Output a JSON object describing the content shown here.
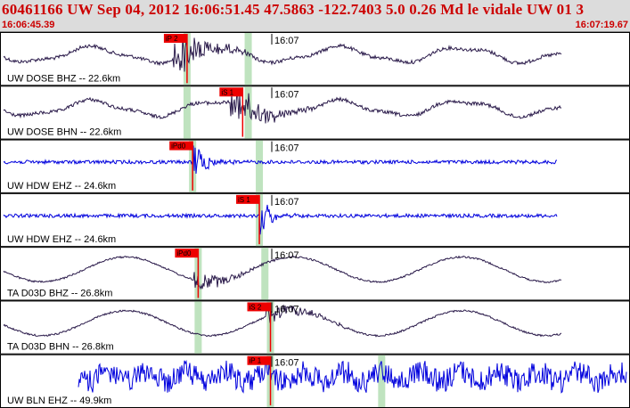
{
  "header": {
    "title": "60461166 UW Sep 04, 2012 16:06:51.45   47.5863 -122.7403  5.0 0.26 Md le vidale UW 01    3",
    "start_time": "16:06:45.39",
    "end_time": "16:07:19.67",
    "tick_time": "16:07"
  },
  "colors": {
    "header_bg": "#dcdcdc",
    "header_text": "#cc0000",
    "trace_dark": "#2a1a4a",
    "trace_blue": "#0000dd",
    "pick_red": "#ee0000",
    "window_green": "#b8e0b8"
  },
  "traces": [
    {
      "label": "UW DOSE BHZ -- 22.6km",
      "color": "dark",
      "style": "long_period",
      "picks": [
        {
          "label": "iP 2",
          "t": 0.33
        }
      ],
      "windows": [
        0.33,
        0.44
      ]
    },
    {
      "label": "UW DOSE BHN -- 22.6km",
      "color": "dark",
      "style": "long_period",
      "picks": [
        {
          "label": "iS 1",
          "t": 0.43
        }
      ],
      "windows": [
        0.33,
        0.44
      ]
    },
    {
      "label": "UW HDW EHZ -- 24.6km",
      "color": "blue",
      "style": "short_period",
      "picks": [
        {
          "label": "iPd0",
          "t": 0.34
        }
      ],
      "windows": [
        0.34,
        0.46
      ]
    },
    {
      "label": "UW HDW EHZ -- 24.6km",
      "color": "blue",
      "style": "short_period",
      "picks": [
        {
          "label": "iS 1",
          "t": 0.46
        }
      ],
      "windows": [
        0.46
      ]
    },
    {
      "label": "TA D03D BHZ -- 26.8km",
      "color": "dark",
      "style": "broadband",
      "picks": [
        {
          "label": "iPd0",
          "t": 0.35
        }
      ],
      "windows": [
        0.35,
        0.47
      ]
    },
    {
      "label": "TA D03D BHN -- 26.8km",
      "color": "dark",
      "style": "broadband",
      "picks": [
        {
          "label": "iS 2",
          "t": 0.48
        }
      ],
      "windows": [
        0.35,
        0.48
      ]
    },
    {
      "label": "UW BLN EHZ -- 49.9km",
      "color": "blue",
      "style": "noisy",
      "picks": [
        {
          "label": "iP 1",
          "t": 0.48
        }
      ],
      "windows": [
        0.48,
        0.68
      ]
    }
  ]
}
